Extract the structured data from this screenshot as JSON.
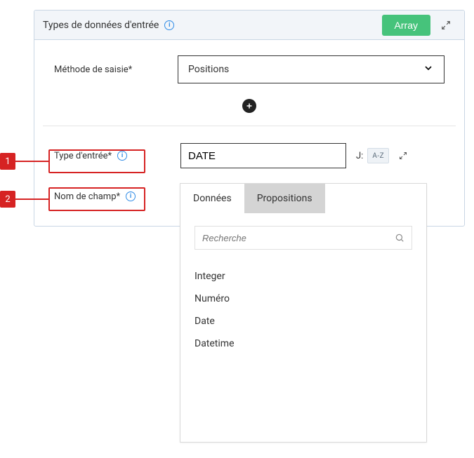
{
  "header": {
    "title": "Types de données d'entrée",
    "array_button": "Array"
  },
  "fields": {
    "method_label": "Méthode de saisie*",
    "method_value": "Positions",
    "type_label": "Type d'entrée*",
    "type_value": "DATE",
    "j_label": "J:",
    "az_label": "A-Z",
    "name_label": "Nom de champ*"
  },
  "popover": {
    "tab_data": "Données",
    "tab_suggest": "Propositions",
    "search_placeholder": "Recherche",
    "options": [
      "Integer",
      "Numéro",
      "Date",
      "Datetime"
    ]
  },
  "callouts": {
    "one": "1",
    "two": "2"
  }
}
